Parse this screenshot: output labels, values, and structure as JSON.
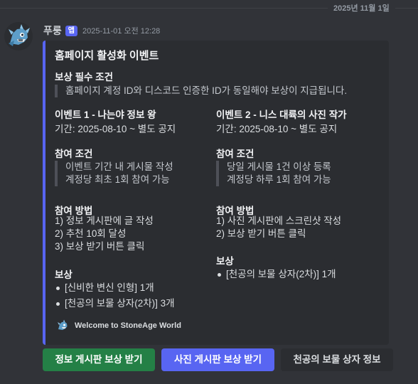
{
  "date_divider": "2025년 11월 1일",
  "message": {
    "username": "푸룽",
    "app_badge": "앱",
    "timestamp": "2025-11-01 오전 12:28"
  },
  "embed": {
    "accent_color": "#5865f2",
    "title": "홈페이지 활성화 이벤트",
    "requirement_name": "보상 필수 조건",
    "requirement_text": "홈페이지 계정 ID와 디스코드 인증한 ID가 동일해야 보상이 지급됩니다.",
    "events": [
      {
        "name": "이벤트 1 - 나는야 정보 왕",
        "period": "기간: 2025-08-10 ~ 별도 공지",
        "conditions_name": "참여 조건",
        "conditions": [
          "이벤트 기간 내 게시물 작성",
          "계정당 최초 1회 참여 가능"
        ],
        "method_name": "참여 방법",
        "methods": [
          "1) 정보 게시판에 글 작성",
          "2) 추천 10회 달성",
          "3) 보상 받기 버튼 클릭"
        ],
        "reward_name": "보상",
        "rewards": [
          "[신비한 변신 인형] 1개",
          "[천공의 보물 상자(2차)] 3개"
        ]
      },
      {
        "name": "이벤트 2 - 니스 대륙의 사진 작가",
        "period": "기간: 2025-08-10 ~ 별도 공지",
        "conditions_name": "참여 조건",
        "conditions": [
          "당일 게시물 1건 이상 등록",
          "계정당 하루 1회 참여 가능"
        ],
        "method_name": "참여 방법",
        "methods": [
          "1) 사진 게시판에 스크린샷 작성",
          "2) 보상 받기 버튼 클릭"
        ],
        "reward_name": "보상",
        "rewards": [
          "[천공의 보물 상자(2차)] 1개"
        ]
      }
    ],
    "footer_text": "Welcome to StoneAge World"
  },
  "buttons": {
    "info_reward": "정보 게시판 보상 받기",
    "photo_reward": "사진 게시판 보상 받기",
    "chest_info": "천공의 보물 상자 정보"
  },
  "colors": {
    "background": "#313338",
    "embed_bg": "#2b2d31",
    "green_button": "#248046",
    "blurple_button": "#5865f2",
    "grey_button": "#2b2d31"
  }
}
